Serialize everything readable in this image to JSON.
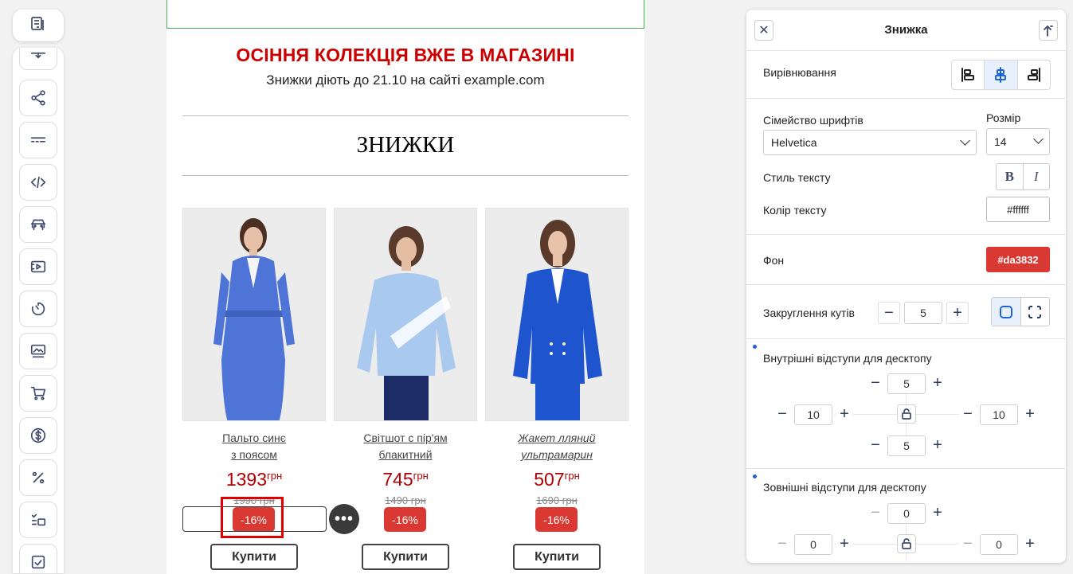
{
  "toolbar": {
    "top_icon": "layout-icon",
    "tools": [
      "divider-icon",
      "share-icon",
      "menu-lines-icon",
      "code-icon",
      "car-icon",
      "video-icon",
      "timer-icon",
      "image-text-icon",
      "cart-icon",
      "dollar-icon",
      "percent-icon",
      "list-check-icon",
      "edit-icon"
    ]
  },
  "email": {
    "headline": "ОСІННЯ КОЛЕКЦІЯ ВЖЕ В МАГАЗИНІ",
    "subline": "Знижки діють до 21.10 на сайті example.com",
    "section_title": "ЗНИЖКИ",
    "currency": "грн",
    "products": [
      {
        "name_line1": "Пальто синє",
        "name_line2": "з поясом",
        "price": "1393",
        "old_price": "1990 грн",
        "badge": "-16%",
        "buy": "Купити",
        "garment_color": "#4d74d6"
      },
      {
        "name_line1": "Світшот с пір'ям",
        "name_line2": "блакитний",
        "price": "745",
        "old_price": "1490 грн",
        "badge": "-16%",
        "buy": "Купити",
        "garment_color": "#aac9ee"
      },
      {
        "name_line1": "Жакет лляний",
        "name_line2": "ультрамарин",
        "price": "507",
        "old_price": "1690 грн",
        "badge": "-16%",
        "buy": "Купити",
        "garment_color": "#1e55cf"
      }
    ],
    "more_button": "•••"
  },
  "panel": {
    "title": "Знижка",
    "close_icon": "close-icon",
    "collapse_icon": "arrow-up-icon",
    "alignment_label": "Вирівнювання",
    "font_family_label": "Сімейство шрифтів",
    "font_family_value": "Helvetica",
    "size_label": "Розмір",
    "size_value": "14",
    "text_style_label": "Стиль тексту",
    "bold": "B",
    "italic": "I",
    "text_color_label": "Колір тексту",
    "text_color_value": "#ffffff",
    "background_label": "Фон",
    "background_value": "#da3832",
    "corner_label": "Закруглення кутів",
    "corner_value": "5",
    "padding_label": "Внутрішні відступи для десктопу",
    "padding": {
      "top": "5",
      "left": "10",
      "right": "10",
      "bottom": "5"
    },
    "margin_label": "Зовнішні відступи для десктопу",
    "margin": {
      "top": "0",
      "left": "0",
      "right": "0"
    },
    "accent": "#1e63d6"
  }
}
